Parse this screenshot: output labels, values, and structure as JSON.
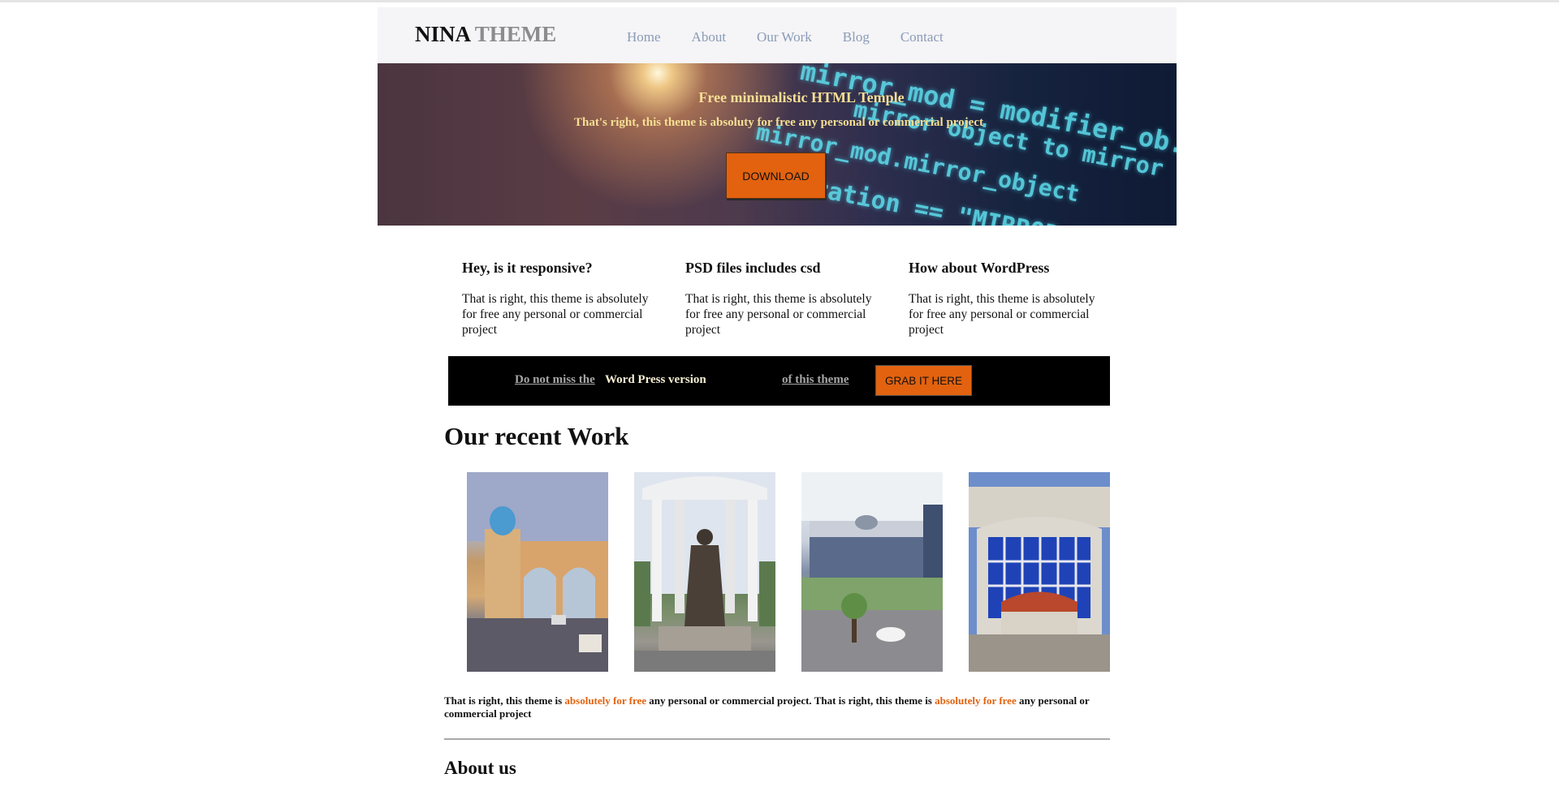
{
  "header": {
    "logo_part1": "NINA",
    "logo_part2": "THEME",
    "nav": [
      "Home",
      "About",
      "Our Work",
      "Blog",
      "Contact"
    ]
  },
  "hero": {
    "title": "Free minimalistic HTML Temple",
    "subtitle": "That's right, this theme is absoluty for free any personal or commercial project",
    "download_label": "DOWNLOAD",
    "code_lines": [
      "mirror_mod = modifier_ob.",
      "mirror object to mirror",
      "mirror_mod.mirror_object",
      "peration == \"MIRROR_X\":"
    ]
  },
  "features": [
    {
      "title": "Hey, is it responsive?",
      "text": "That is right, this theme is absolutely for free any personal or commercial project"
    },
    {
      "title": "PSD files includes csd",
      "text": "That is right, this theme is absolutely for free any personal or commercial project"
    },
    {
      "title": "How about WordPress",
      "text": "That is right, this theme is absolutely for free any personal or commercial project"
    }
  ],
  "banner": {
    "text1": "Do not miss the",
    "text2": "Word Press version",
    "text3": "of this theme",
    "button_label": "GRAB IT HERE"
  },
  "recent": {
    "title": "Our recent Work",
    "photos": [
      "gate-photo",
      "monument-photo",
      "building-photo",
      "taj-mahal-building-photo"
    ]
  },
  "paragraph": {
    "a": "That is right, this theme is ",
    "hl1": "absolutely for free",
    "b": " any personal or commercial project. That is right, this theme is ",
    "hl2": "absolutely for free",
    "c": " any personal or commercial project"
  },
  "about": {
    "title": "About us"
  },
  "colors": {
    "accent": "#e2620f",
    "nav": "#8a9bb7",
    "hero_text": "#f6df94"
  }
}
